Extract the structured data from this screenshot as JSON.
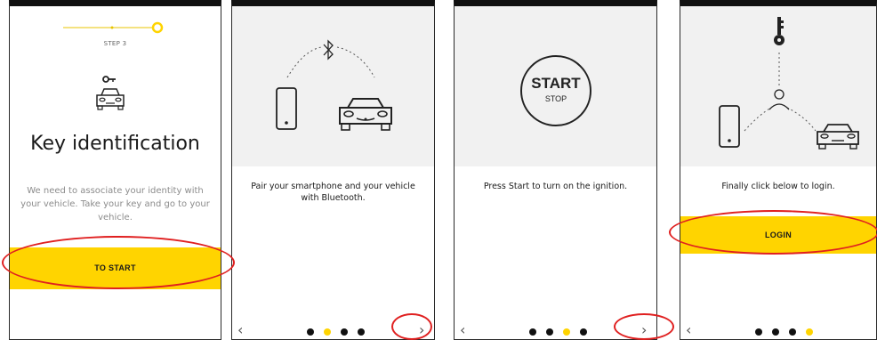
{
  "screens": [
    {
      "step_label": "STEP 3",
      "title": "Key identification",
      "description": "We need to associate your identity with your vehicle. Take your key and go to your vehicle.",
      "button_label": "TO START"
    },
    {
      "caption": "Pair your smartphone and your vehicle with Bluetooth.",
      "active_dot": 1,
      "dot_count": 4
    },
    {
      "start_label": "START",
      "stop_label": "STOP",
      "caption": "Press Start to turn on the ignition.",
      "active_dot": 2,
      "dot_count": 4
    },
    {
      "caption": "Finally click below to login.",
      "button_label": "LOGIN",
      "active_dot": 3,
      "dot_count": 4
    }
  ],
  "nav": {
    "prev_glyph": "‹",
    "next_glyph": "›"
  },
  "colors": {
    "accent": "#ffd400",
    "highlight_ring": "#e02020",
    "illustration_bg": "#f1f1f1"
  },
  "icons": [
    "key-icon",
    "car-icon",
    "smartphone-icon",
    "bluetooth-icon",
    "start-stop-button-icon",
    "person-icon"
  ]
}
